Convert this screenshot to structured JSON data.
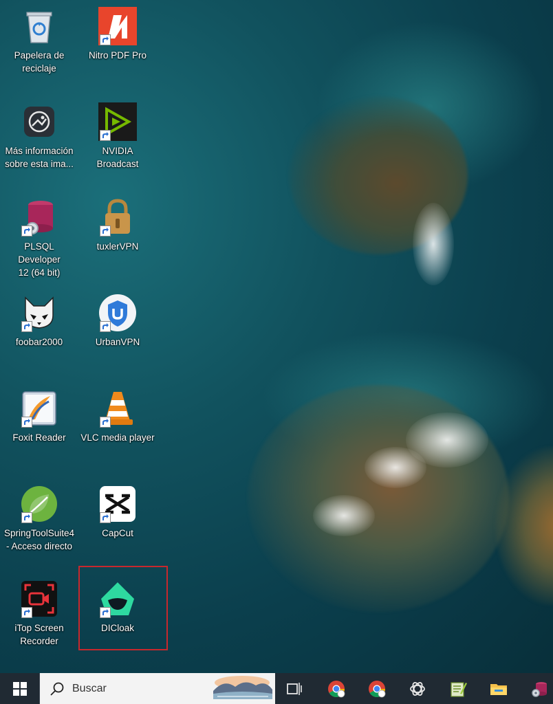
{
  "desktop": {
    "icons": [
      {
        "id": "recycle-bin",
        "label": "Papelera de\nreciclaje",
        "shortcut": false
      },
      {
        "id": "nitro-pdf-pro",
        "label": "Nitro PDF Pro",
        "shortcut": true
      },
      {
        "id": "image-info",
        "label": "Más información\nsobre esta ima...",
        "shortcut": false
      },
      {
        "id": "nvidia-broadcast",
        "label": "NVIDIA\nBroadcast",
        "shortcut": true
      },
      {
        "id": "plsql-developer",
        "label": "PLSQL Developer\n12 (64 bit)",
        "shortcut": true
      },
      {
        "id": "tuxlervpn",
        "label": "tuxlerVPN",
        "shortcut": true
      },
      {
        "id": "foobar2000",
        "label": "foobar2000",
        "shortcut": true
      },
      {
        "id": "urbanvpn",
        "label": "UrbanVPN",
        "shortcut": true
      },
      {
        "id": "foxit-reader",
        "label": "Foxit Reader",
        "shortcut": true
      },
      {
        "id": "vlc-media-player",
        "label": "VLC media player",
        "shortcut": true
      },
      {
        "id": "springtoolsuite4",
        "label": "SpringToolSuite4\n- Acceso directo",
        "shortcut": true
      },
      {
        "id": "capcut",
        "label": "CapCut",
        "shortcut": true
      },
      {
        "id": "itop-screen-recorder",
        "label": "iTop Screen\nRecorder",
        "shortcut": true
      },
      {
        "id": "dicloak",
        "label": "DICloak",
        "shortcut": true,
        "selected": true
      }
    ]
  },
  "taskbar": {
    "search_placeholder": "Buscar",
    "buttons": [
      "task-view",
      "chrome-profile-w",
      "chrome-profile-e",
      "chatgpt",
      "notepad-plus",
      "file-explorer",
      "plsql-developer"
    ]
  },
  "colors": {
    "taskbar_bg": "#202a33",
    "selection_border": "#c8282d",
    "nitro_red": "#e8452c",
    "dicloak_green": "#2ed9a0"
  }
}
